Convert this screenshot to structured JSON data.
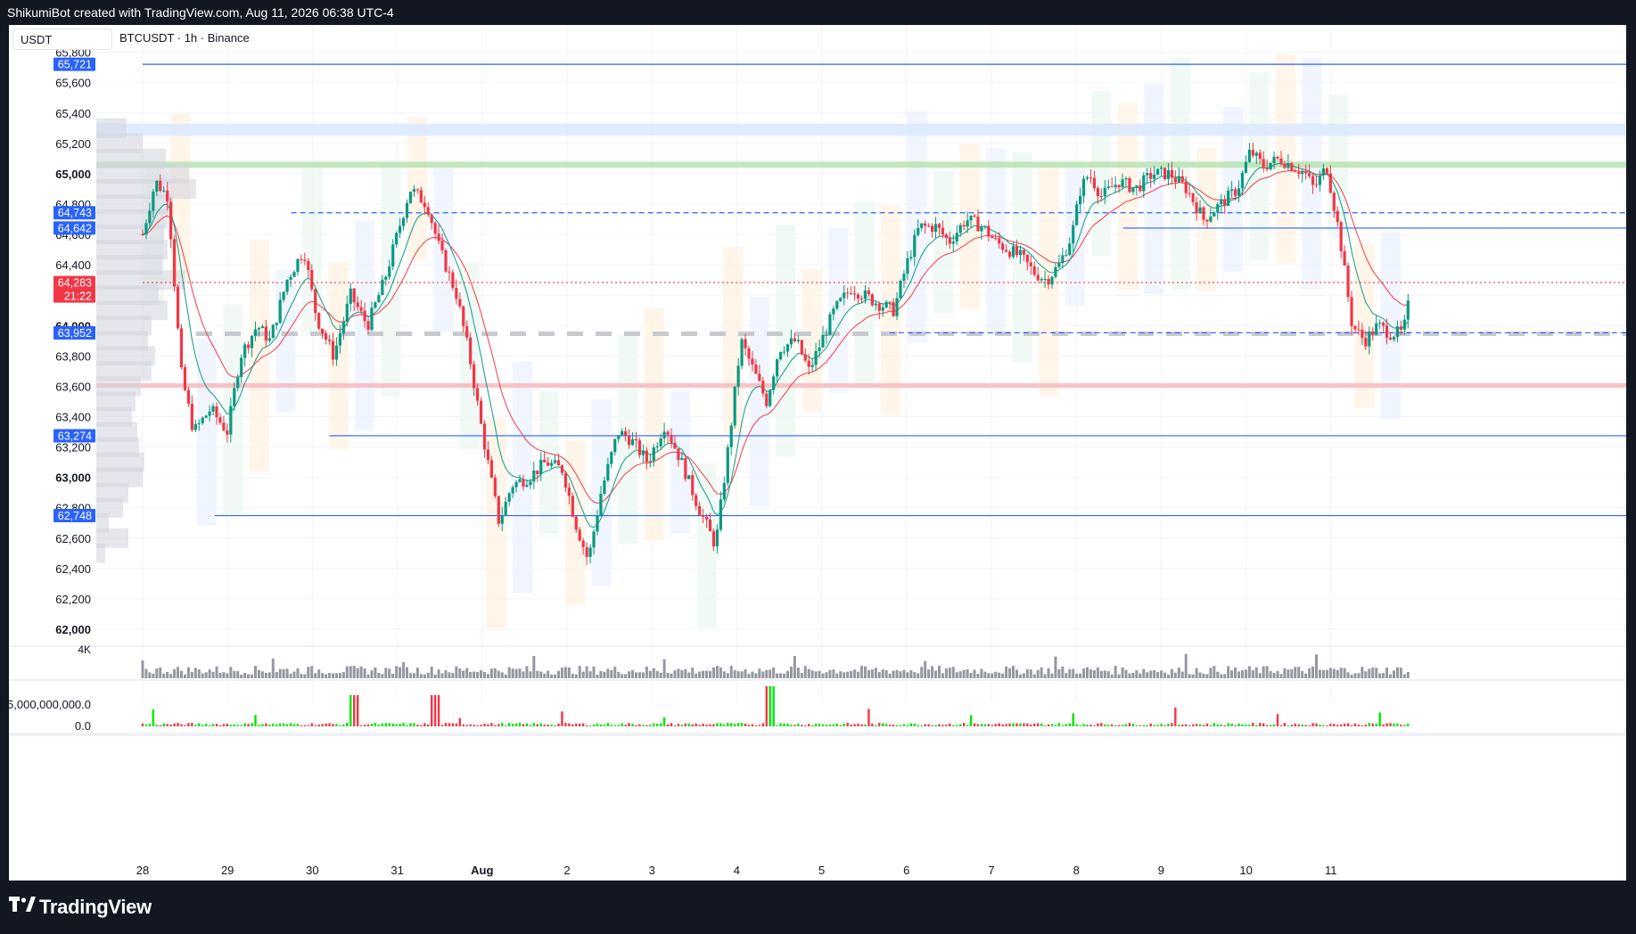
{
  "header": {
    "attribution": "ShikumiBot created with TradingView.com, Aug 11, 2026 06:38 UTC-4"
  },
  "toolbar": {
    "currency": "USDT",
    "symbol_title": "BTCUSDT · 1h · Binance"
  },
  "footer": {
    "brand": "TradingView",
    "logo_icon": "tradingview-logo-icon"
  },
  "colors": {
    "up": "#089981",
    "down": "#f23645",
    "line_blue": "#2962ff",
    "ema_red": "#f23645",
    "ema_green": "#089981",
    "zone_green": "#b7e3b0",
    "zone_red": "#f7b8bd",
    "zone_blue": "#dbe7ff",
    "dashed_gray": "#c7c9cf"
  },
  "chart_data": {
    "type": "candlestick",
    "xlabels": [
      "28",
      "29",
      "30",
      "31",
      "Aug",
      "2",
      "3",
      "4",
      "5",
      "6",
      "7",
      "8",
      "9",
      "10",
      "11"
    ],
    "price_ticks": [
      "65,800",
      "65,600",
      "65,400",
      "65,200",
      "65,000",
      "64,800",
      "64,600",
      "64,400",
      "64,200",
      "64,000",
      "63,800",
      "63,600",
      "63,400",
      "63,200",
      "63,000",
      "62,800",
      "62,600",
      "62,400",
      "62,200",
      "62,000"
    ],
    "price_levels": [
      65800,
      65600,
      65400,
      65200,
      65000,
      64800,
      64600,
      64400,
      64200,
      64000,
      63800,
      63600,
      63400,
      63200,
      63000,
      62800,
      62600,
      62400,
      62200,
      62000
    ],
    "bold_ticks": [
      "65,000",
      "64,000",
      "63,000",
      "62,000"
    ],
    "ylim": [
      61900,
      65980
    ],
    "badges": [
      {
        "label": "65,721",
        "price": 65721,
        "color": "#2962ff"
      },
      {
        "label": "64,743",
        "price": 64743,
        "color": "#2962ff"
      },
      {
        "label": "64,642",
        "price": 64642,
        "color": "#2962ff"
      },
      {
        "label": "64,283",
        "price": 64283,
        "color": "#f23645",
        "sub": "21:22"
      },
      {
        "label": "63,952",
        "price": 63952,
        "color": "#2962ff"
      },
      {
        "label": "63,274",
        "price": 63274,
        "color": "#2962ff"
      },
      {
        "label": "62,748",
        "price": 62748,
        "color": "#2962ff"
      }
    ],
    "hlines": [
      {
        "price": 65721,
        "from": 0,
        "style": "solid",
        "color": "#2962ff"
      },
      {
        "price": 64743,
        "from": 1.75,
        "style": "dashed",
        "color": "#2962ff"
      },
      {
        "price": 64642,
        "from": 11.55,
        "style": "solid",
        "color": "#2962ff"
      },
      {
        "price": 64283,
        "from": 0,
        "style": "dotted",
        "color": "#f23645"
      },
      {
        "price": 63952,
        "from": 8.8,
        "style": "dashed",
        "color": "#2962ff"
      },
      {
        "price": 63274,
        "from": 2.2,
        "style": "solid",
        "color": "#2962ff"
      },
      {
        "price": 62748,
        "from": 0.85,
        "style": "solid",
        "color": "#2962ff"
      }
    ],
    "zones": [
      {
        "low": 65250,
        "high": 65330,
        "color": "#dbe7ff"
      },
      {
        "low": 65040,
        "high": 65080,
        "color": "#b7e3b0"
      },
      {
        "low": 63590,
        "high": 63620,
        "color": "#f7b8bd"
      }
    ],
    "dashed_gray_level": 63952,
    "volume_profile": [
      {
        "price": 65300,
        "w": 34
      },
      {
        "price": 65200,
        "w": 52
      },
      {
        "price": 65100,
        "w": 78
      },
      {
        "price": 65000,
        "w": 104
      },
      {
        "price": 64900,
        "w": 112
      },
      {
        "price": 64800,
        "w": 86
      },
      {
        "price": 64700,
        "w": 80
      },
      {
        "price": 64600,
        "w": 76
      },
      {
        "price": 64500,
        "w": 80
      },
      {
        "price": 64400,
        "w": 74
      },
      {
        "price": 64300,
        "w": 100
      },
      {
        "price": 64200,
        "w": 70
      },
      {
        "price": 64100,
        "w": 80
      },
      {
        "price": 64000,
        "w": 62
      },
      {
        "price": 63900,
        "w": 58
      },
      {
        "price": 63800,
        "w": 66
      },
      {
        "price": 63700,
        "w": 62
      },
      {
        "price": 63600,
        "w": 50
      },
      {
        "price": 63500,
        "w": 44
      },
      {
        "price": 63400,
        "w": 40
      },
      {
        "price": 63300,
        "w": 46
      },
      {
        "price": 63200,
        "w": 48
      },
      {
        "price": 63100,
        "w": 54
      },
      {
        "price": 63000,
        "w": 52
      },
      {
        "price": 62900,
        "w": 36
      },
      {
        "price": 62800,
        "w": 30
      },
      {
        "price": 62700,
        "w": 14
      },
      {
        "price": 62600,
        "w": 36
      },
      {
        "price": 62500,
        "w": 10
      }
    ],
    "close_path": [
      [
        0,
        64600
      ],
      [
        0.15,
        64950
      ],
      [
        0.3,
        64850
      ],
      [
        0.45,
        63700
      ],
      [
        0.6,
        63300
      ],
      [
        0.8,
        63450
      ],
      [
        1.0,
        63300
      ],
      [
        1.15,
        63800
      ],
      [
        1.35,
        64000
      ],
      [
        1.5,
        63900
      ],
      [
        1.7,
        64300
      ],
      [
        1.9,
        64500
      ],
      [
        2.05,
        64050
      ],
      [
        2.25,
        63800
      ],
      [
        2.45,
        64200
      ],
      [
        2.65,
        64000
      ],
      [
        2.85,
        64300
      ],
      [
        3.0,
        64600
      ],
      [
        3.15,
        64900
      ],
      [
        3.35,
        64800
      ],
      [
        3.5,
        64500
      ],
      [
        3.7,
        64200
      ],
      [
        3.85,
        63800
      ],
      [
        4.0,
        63300
      ],
      [
        4.2,
        62700
      ],
      [
        4.35,
        62950
      ],
      [
        4.55,
        63000
      ],
      [
        4.75,
        63100
      ],
      [
        4.95,
        63050
      ],
      [
        5.1,
        62700
      ],
      [
        5.25,
        62450
      ],
      [
        5.4,
        62900
      ],
      [
        5.6,
        63300
      ],
      [
        5.75,
        63250
      ],
      [
        5.95,
        63100
      ],
      [
        6.15,
        63350
      ],
      [
        6.35,
        63100
      ],
      [
        6.55,
        62800
      ],
      [
        6.75,
        62550
      ],
      [
        6.9,
        63200
      ],
      [
        7.05,
        63900
      ],
      [
        7.2,
        63700
      ],
      [
        7.35,
        63500
      ],
      [
        7.5,
        63850
      ],
      [
        7.7,
        63900
      ],
      [
        7.85,
        63700
      ],
      [
        8.0,
        63900
      ],
      [
        8.15,
        64100
      ],
      [
        8.35,
        64250
      ],
      [
        8.5,
        64200
      ],
      [
        8.65,
        64150
      ],
      [
        8.85,
        64100
      ],
      [
        9.0,
        64400
      ],
      [
        9.15,
        64650
      ],
      [
        9.35,
        64650
      ],
      [
        9.5,
        64550
      ],
      [
        9.7,
        64700
      ],
      [
        9.9,
        64650
      ],
      [
        10.05,
        64550
      ],
      [
        10.2,
        64500
      ],
      [
        10.35,
        64450
      ],
      [
        10.5,
        64350
      ],
      [
        10.65,
        64300
      ],
      [
        10.8,
        64400
      ],
      [
        10.95,
        64600
      ],
      [
        11.05,
        64900
      ],
      [
        11.15,
        65000
      ],
      [
        11.3,
        64850
      ],
      [
        11.5,
        64950
      ],
      [
        11.7,
        64900
      ],
      [
        11.9,
        65000
      ],
      [
        12.1,
        65000
      ],
      [
        12.3,
        64900
      ],
      [
        12.5,
        64700
      ],
      [
        12.7,
        64800
      ],
      [
        12.9,
        64900
      ],
      [
        13.05,
        65150
      ],
      [
        13.2,
        65050
      ],
      [
        13.4,
        65100
      ],
      [
        13.55,
        65050
      ],
      [
        13.7,
        65000
      ],
      [
        13.8,
        64900
      ],
      [
        13.95,
        65050
      ],
      [
        14.1,
        64600
      ],
      [
        14.25,
        64000
      ],
      [
        14.4,
        63900
      ],
      [
        14.55,
        64000
      ],
      [
        14.7,
        63950
      ],
      [
        14.85,
        63950
      ],
      [
        14.95,
        64250
      ]
    ],
    "panes": [
      {
        "name": "volume",
        "ticks": [
          "4K"
        ]
      },
      {
        "name": "oscillator",
        "ticks": [
          "5,000,000,000.0",
          "0.0"
        ]
      }
    ]
  }
}
